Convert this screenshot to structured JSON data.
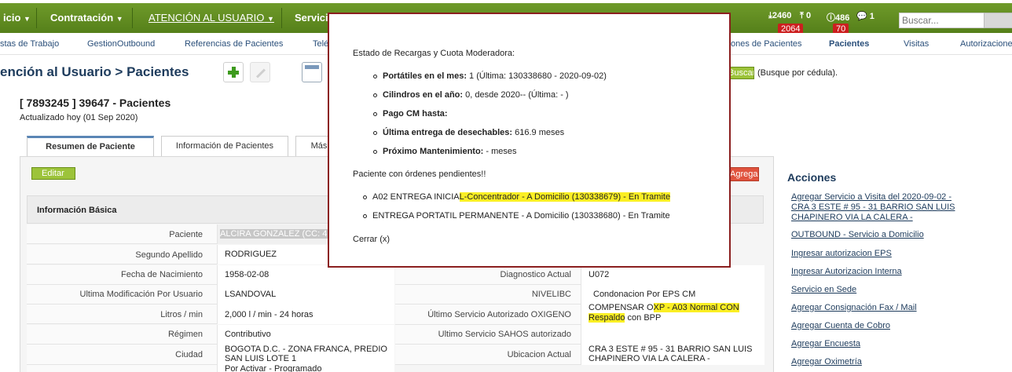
{
  "nav": {
    "items": [
      "icio",
      "Contratación",
      "ATENCIÓN AL USUARIO",
      "Servicio"
    ],
    "counts": {
      "download": "2460",
      "download_badge": "2064",
      "upload": "0",
      "alert": "486",
      "alert_badge": "70",
      "messages": "1"
    },
    "search_placeholder": "Buscar..."
  },
  "subnav": [
    "stas de Trabajo",
    "GestionOutbound",
    "Referencias de Pacientes",
    "Telé",
    "ones de Pacientes",
    "Pacientes",
    "Visitas",
    "Autorizacione"
  ],
  "breadcrumb": "ención al Usuario > Pacientes",
  "search_button": "Buscar paciente...",
  "cedula_hint": "(Busque por cédula).",
  "patient": {
    "title": "[ 7893245 ] 39647 - Pacientes",
    "updated": "Actualizado hoy (01 Sep 2020)"
  },
  "tabs": [
    "Resumen de Paciente",
    "Información de Pacientes",
    "Más"
  ],
  "buttons": {
    "edit": "Editar",
    "service": "Agregar Servicio"
  },
  "info_header": "Información Básica",
  "left_rows": [
    {
      "label": "Paciente",
      "value": "ALCIRA GONZALEZ (CC: 41"
    },
    {
      "label": "Segundo Apellido",
      "value": "RODRIGUEZ"
    },
    {
      "label": "Fecha de Nacimiento",
      "value": "1958-02-08"
    },
    {
      "label": "Ultima Modificación Por Usuario",
      "value": "LSANDOVAL"
    },
    {
      "label": "Litros / min",
      "value": "2,000 l / min - 24 horas"
    },
    {
      "label": "Régimen",
      "value": "Contributivo"
    },
    {
      "label": "Ciudad",
      "value": "BOGOTA D.C. - ZONA FRANCA, PREDIO SAN LUIS LOTE 1"
    },
    {
      "label": "",
      "value": "Por Activar - Programado"
    }
  ],
  "right_rows": [
    {
      "label": "Diagnostico Actual",
      "value": "U072"
    },
    {
      "label": "NIVELIBC",
      "value": "Condonacion Por EPS CM"
    },
    {
      "label": "Último Servicio Autorizado OXIGENO",
      "value_pre": "COMPENSAR O",
      "value_hl": "XP - A03 Normal CON Respaldo",
      "value_post": " con BPP"
    },
    {
      "label": "Ultimo Servicio SAHOS autorizado",
      "value": ""
    },
    {
      "label": "Ubicacion Actual",
      "value": "CRA 3 ESTE # 95 - 31 BARRIO SAN LUIS CHAPINERO VIA LA CALERA -"
    }
  ],
  "modal": {
    "heading": "Estado de Recargas y Cuota Moderadora:",
    "items": [
      {
        "bold": "Portátiles en el mes:",
        "text": " 1 (Última: 130338680 - 2020-09-02)"
      },
      {
        "bold": "Cilindros en el año:",
        "text": " 0, desde 2020-- (Última: - )"
      },
      {
        "bold": "Pago CM hasta:",
        "text": ""
      },
      {
        "bold": "Última entrega de desechables:",
        "text": " 616.9 meses"
      },
      {
        "bold": "Próximo Mantenimiento:",
        "text": " - meses"
      }
    ],
    "pending_heading": "Paciente con órdenes pendientes!!",
    "pending": [
      {
        "pre": "A02 ENTREGA INICIA",
        "hl": "L-Concentrador - A Domicilio (130338679) - En Tramite"
      },
      {
        "pre": "ENTREGA PORTATIL PERMANENTE - A Domicilio (130338680) - En Tramite",
        "hl": ""
      }
    ],
    "close": "Cerrar (x)"
  },
  "actions": {
    "title": "Acciones",
    "items": [
      "Agregar Servicio a Visita del 2020-09-02 -",
      "CRA 3 ESTE # 95 - 31 BARRIO SAN LUIS",
      "CHAPINERO VIA LA CALERA -",
      "OUTBOUND - Servicio a Domicilio",
      "Ingresar autorizacion EPS",
      "Ingresar Autorizacion Interna",
      "Servicio en Sede",
      "Agregar Consignación Fax / Mail",
      "Agregar Cuenta de Cobro",
      "Agregar Encuesta",
      "Agregar Oximetría"
    ]
  },
  "colors": {
    "nav_green": "#5f8c22",
    "highlight": "#fbef24",
    "modal_border": "#8b1f1f",
    "link": "#1d3b5c",
    "alert_red": "#cc1f1f"
  }
}
